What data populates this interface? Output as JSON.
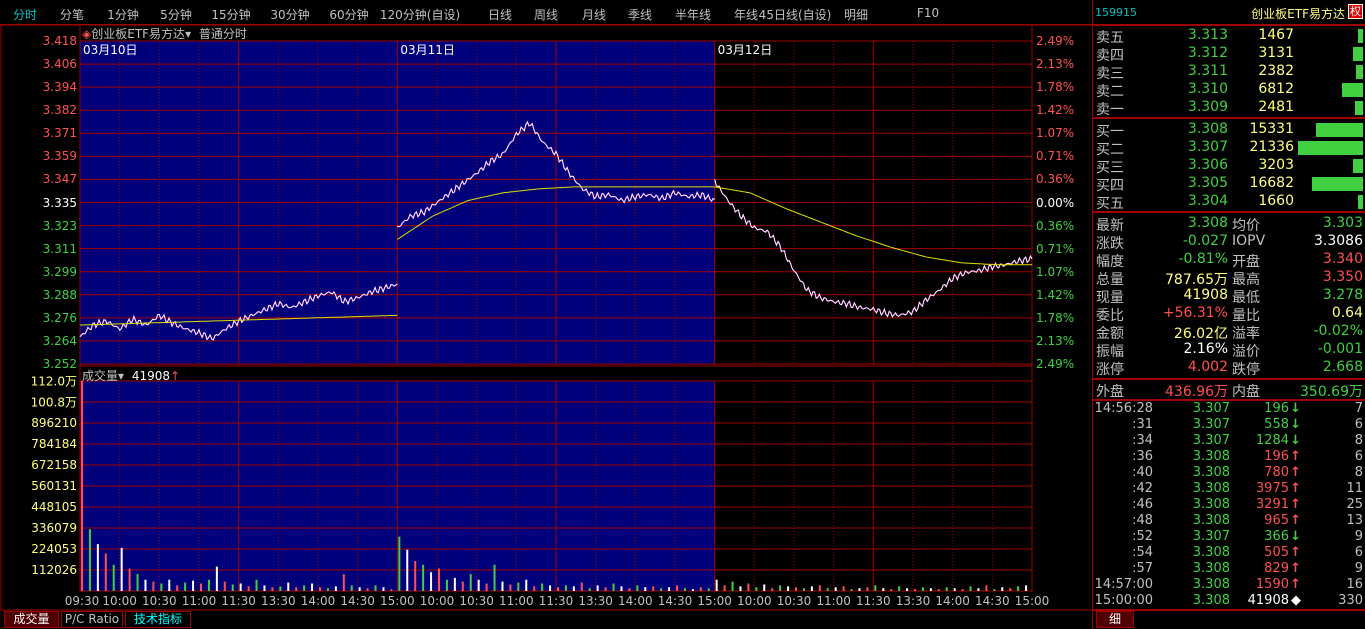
{
  "menu": [
    "分时",
    "分笔",
    "1分钟",
    "5分钟",
    "15分钟",
    "30分钟",
    "60分钟",
    "120分钟(自设)",
    "日线",
    "周线",
    "月线",
    "季线",
    "半年线",
    "年线",
    "45日线(自设)",
    "明细",
    "F10"
  ],
  "chart_header": {
    "title": "创业板ETF易方达",
    "mode": "普通分时",
    "days": [
      "03月10日",
      "03月11日",
      "03月12日"
    ]
  },
  "price_axis": {
    "left": [
      "3.418",
      "3.406",
      "3.394",
      "3.382",
      "3.371",
      "3.359",
      "3.347",
      "3.335",
      "3.323",
      "3.311",
      "3.299",
      "3.288",
      "3.276",
      "3.264",
      "3.252"
    ],
    "right": [
      "2.49%",
      "2.13%",
      "1.78%",
      "1.42%",
      "1.07%",
      "0.71%",
      "0.36%",
      "0.00%",
      "0.36%",
      "0.71%",
      "1.07%",
      "1.42%",
      "1.78%",
      "2.13%",
      "2.49%"
    ]
  },
  "volume_header": {
    "label": "成交量",
    "value": "41908",
    "arrow": "↑"
  },
  "volume_axis": [
    "112.0万",
    "100.8万",
    "896210",
    "784184",
    "672158",
    "560131",
    "448105",
    "336079",
    "224053",
    "112026"
  ],
  "time_axis": [
    "09:30",
    "10:00",
    "10:30",
    "11:00",
    "11:30",
    "13:30",
    "14:00",
    "14:30",
    "15:00",
    "10:00",
    "10:30",
    "11:00",
    "11:30",
    "13:30",
    "14:00",
    "14:30",
    "15:00",
    "10:00",
    "10:30",
    "11:00",
    "11:30",
    "13:30",
    "14:00",
    "14:30",
    "15:00"
  ],
  "bottom_tabs": [
    "成交量",
    "P/C Ratio",
    "技术指标"
  ],
  "colors": {
    "grid": "#a00000",
    "up": "#ff5050",
    "down": "#40d040",
    "price_line": "#ffffff",
    "avg_line": "#e0e000",
    "blue_bg": "#00007a"
  },
  "chart_data": {
    "type": "line",
    "prev_close": 3.335,
    "ylim": [
      3.252,
      3.418
    ],
    "price": [
      [
        3.266,
        3.272,
        3.274,
        3.27,
        3.275,
        3.272,
        3.277,
        3.273,
        3.27,
        3.268,
        3.265,
        3.27,
        3.274,
        3.277,
        3.28,
        3.283,
        3.281,
        3.284,
        3.287,
        3.289,
        3.284,
        3.286,
        3.289,
        3.291,
        3.293
      ],
      [
        3.322,
        3.328,
        3.33,
        3.335,
        3.34,
        3.345,
        3.35,
        3.356,
        3.36,
        3.37,
        3.376,
        3.366,
        3.36,
        3.35,
        3.342,
        3.338,
        3.339,
        3.336,
        3.338,
        3.339,
        3.337,
        3.34,
        3.338,
        3.339,
        3.336
      ],
      [
        3.346,
        3.336,
        3.328,
        3.322,
        3.32,
        3.312,
        3.3,
        3.29,
        3.286,
        3.284,
        3.283,
        3.281,
        3.28,
        3.278,
        3.277,
        3.279,
        3.285,
        3.29,
        3.296,
        3.299,
        3.3,
        3.302,
        3.303,
        3.305,
        3.306
      ]
    ],
    "avg": [
      [
        3.272,
        3.273,
        3.274,
        3.275,
        3.276,
        3.277
      ],
      [
        3.316,
        3.328,
        3.336,
        3.34,
        3.342,
        3.343,
        3.343,
        3.343,
        3.343,
        3.343
      ],
      [
        3.343,
        3.34,
        3.332,
        3.325,
        3.318,
        3.312,
        3.307,
        3.304,
        3.303,
        3.303
      ]
    ],
    "volume_max": 1120000,
    "volume": [
      [
        1120000,
        330000,
        250000,
        200000,
        140000,
        230000,
        120000,
        90000,
        60000,
        50000,
        40000,
        60000,
        30000,
        45000,
        55000,
        40000,
        60000,
        130000,
        50000,
        35000,
        40000,
        25000,
        60000,
        30000,
        20000,
        25000,
        45000,
        20000,
        30000,
        40000,
        20000,
        15000,
        25000,
        90000,
        30000,
        20000,
        15000,
        30000,
        20000,
        10000
      ],
      [
        290000,
        220000,
        160000,
        140000,
        100000,
        120000,
        60000,
        70000,
        50000,
        90000,
        60000,
        40000,
        140000,
        50000,
        35000,
        45000,
        60000,
        25000,
        40000,
        30000,
        20000,
        30000,
        25000,
        45000,
        15000,
        30000,
        20000,
        40000,
        25000,
        15000,
        30000,
        20000,
        25000,
        15000,
        20000,
        30000,
        15000,
        10000,
        20000,
        15000
      ],
      [
        60000,
        30000,
        50000,
        25000,
        40000,
        20000,
        35000,
        15000,
        30000,
        25000,
        20000,
        15000,
        25000,
        30000,
        15000,
        20000,
        25000,
        10000,
        15000,
        20000,
        30000,
        15000,
        10000,
        25000,
        15000,
        10000,
        20000,
        15000,
        10000,
        20000,
        15000,
        10000,
        25000,
        15000,
        30000,
        10000,
        20000,
        15000,
        25000,
        30000
      ]
    ]
  },
  "quote": {
    "code": "159915",
    "name": "创业板ETF易方达",
    "badge": "权",
    "sells": [
      {
        "label": "卖五",
        "price": "3.313",
        "vol": "1467",
        "n": 1467
      },
      {
        "label": "卖四",
        "price": "3.312",
        "vol": "3131",
        "n": 3131
      },
      {
        "label": "卖三",
        "price": "3.311",
        "vol": "2382",
        "n": 2382
      },
      {
        "label": "卖二",
        "price": "3.310",
        "vol": "6812",
        "n": 6812
      },
      {
        "label": "卖一",
        "price": "3.309",
        "vol": "2481",
        "n": 2481
      }
    ],
    "buys": [
      {
        "label": "买一",
        "price": "3.308",
        "vol": "15331",
        "n": 15331
      },
      {
        "label": "买二",
        "price": "3.307",
        "vol": "21336",
        "n": 21336
      },
      {
        "label": "买三",
        "price": "3.306",
        "vol": "3203",
        "n": 3203
      },
      {
        "label": "买四",
        "price": "3.305",
        "vol": "16682",
        "n": 16682
      },
      {
        "label": "买五",
        "price": "3.304",
        "vol": "1660",
        "n": 1660
      }
    ],
    "stats": [
      {
        "l1": "最新",
        "v1": "3.308",
        "c1": "g",
        "l2": "均价",
        "v2": "3.303",
        "c2": "g"
      },
      {
        "l1": "涨跌",
        "v1": "-0.027",
        "c1": "g",
        "l2": "IOPV",
        "v2": "3.3086",
        "c2": "w"
      },
      {
        "l1": "幅度",
        "v1": "-0.81%",
        "c1": "g",
        "l2": "开盘",
        "v2": "3.340",
        "c2": "r"
      },
      {
        "l1": "总量",
        "v1": "787.65万",
        "c1": "y",
        "l2": "最高",
        "v2": "3.350",
        "c2": "r"
      },
      {
        "l1": "现量",
        "v1": "41908",
        "c1": "y",
        "l2": "最低",
        "v2": "3.278",
        "c2": "g"
      },
      {
        "l1": "委比",
        "v1": "+56.31%",
        "c1": "r",
        "l2": "量比",
        "v2": "0.64",
        "c2": "y"
      },
      {
        "l1": "金额",
        "v1": "26.02亿",
        "c1": "y",
        "l2": "溢率",
        "v2": "-0.02%",
        "c2": "g"
      },
      {
        "l1": "振幅",
        "v1": "2.16%",
        "c1": "w",
        "l2": "溢价",
        "v2": "-0.001",
        "c2": "g"
      },
      {
        "l1": "涨停",
        "v1": "4.002",
        "c1": "r",
        "l2": "跌停",
        "v2": "2.668",
        "c2": "g"
      }
    ],
    "outer": {
      "l1": "外盘",
      "v1": "436.96万",
      "l2": "内盘",
      "v2": "350.69万"
    },
    "ticks": [
      {
        "t": "14:56:28",
        "p": "3.307",
        "v": "196",
        "a": "↓",
        "c": "g",
        "n": "7"
      },
      {
        "t": ":31",
        "p": "3.307",
        "v": "558",
        "a": "↓",
        "c": "g",
        "n": "6"
      },
      {
        "t": ":34",
        "p": "3.307",
        "v": "1284",
        "a": "↓",
        "c": "g",
        "n": "8"
      },
      {
        "t": ":36",
        "p": "3.308",
        "v": "196",
        "a": "↑",
        "c": "r",
        "n": "6"
      },
      {
        "t": ":40",
        "p": "3.308",
        "v": "780",
        "a": "↑",
        "c": "r",
        "n": "8"
      },
      {
        "t": ":42",
        "p": "3.308",
        "v": "3975",
        "a": "↑",
        "c": "r",
        "n": "11"
      },
      {
        "t": ":46",
        "p": "3.308",
        "v": "3291",
        "a": "↑",
        "c": "r",
        "n": "25"
      },
      {
        "t": ":48",
        "p": "3.308",
        "v": "965",
        "a": "↑",
        "c": "r",
        "n": "13"
      },
      {
        "t": ":52",
        "p": "3.307",
        "v": "366",
        "a": "↓",
        "c": "g",
        "n": "9"
      },
      {
        "t": ":54",
        "p": "3.308",
        "v": "505",
        "a": "↑",
        "c": "r",
        "n": "6"
      },
      {
        "t": ":57",
        "p": "3.308",
        "v": "829",
        "a": "↑",
        "c": "r",
        "n": "9"
      },
      {
        "t": "14:57:00",
        "p": "3.308",
        "v": "1590",
        "a": "↑",
        "c": "r",
        "n": "16"
      },
      {
        "t": "15:00:00",
        "p": "3.308",
        "v": "41908",
        "a": "◆",
        "c": "w",
        "n": "330"
      }
    ],
    "detail_tab": "细"
  }
}
